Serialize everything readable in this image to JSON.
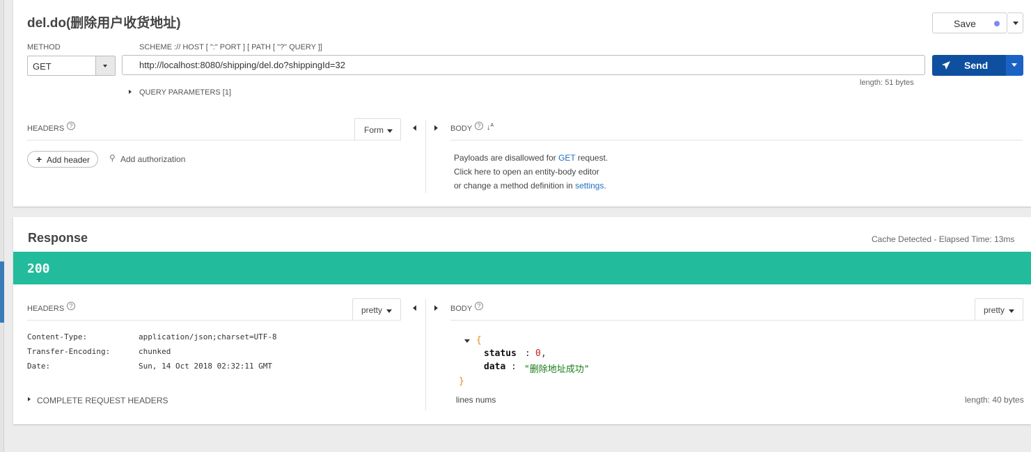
{
  "request": {
    "title": "del.do(删除用户收货地址)",
    "save_label": "Save",
    "method_label": "METHOD",
    "method_value": "GET",
    "url_label": "SCHEME :// HOST [ \":\" PORT ] [ PATH [ \"?\" QUERY ]]",
    "url_value": "http://localhost:8080/shipping/del.do?shippingId=32",
    "send_label": "Send",
    "length_text": "length: 51 bytes",
    "query_params_label": "QUERY PARAMETERS [1]",
    "headers_label": "HEADERS",
    "headers_mode": "Form",
    "add_header_label": "Add header",
    "add_auth_label": "Add authorization",
    "body_label": "BODY",
    "body_msg_prefix": "Payloads are disallowed for ",
    "body_msg_method": "GET",
    "body_msg_suffix": " request.",
    "body_click_here": "Click here to open an entity-body editor",
    "body_change_prefix": "or change a method definition in ",
    "body_settings_link": "settings",
    "body_change_suffix": "."
  },
  "response": {
    "title": "Response",
    "cache_text": "Cache Detected - Elapsed Time: 13ms",
    "status_code": "200",
    "status_color": "#22bc9c",
    "headers_label": "HEADERS",
    "headers_mode": "pretty",
    "body_label": "BODY",
    "body_mode": "pretty",
    "headers": [
      {
        "name": "Content-Type:",
        "value": "application/json;charset=UTF-8"
      },
      {
        "name": "Transfer-Encoding:",
        "value": "chunked"
      },
      {
        "name": "Date:",
        "value": "Sun, 14 Oct 2018 02:32:11 GMT"
      }
    ],
    "complete_headers_label": "COMPLETE REQUEST HEADERS",
    "json": {
      "open_brace": "{",
      "close_brace": "}",
      "status_key": "status",
      "status_value": "0",
      "data_key": "data",
      "data_value": "\"删除地址成功\""
    },
    "lines_nums_label": "lines nums",
    "length_text": "length: 40 bytes"
  }
}
